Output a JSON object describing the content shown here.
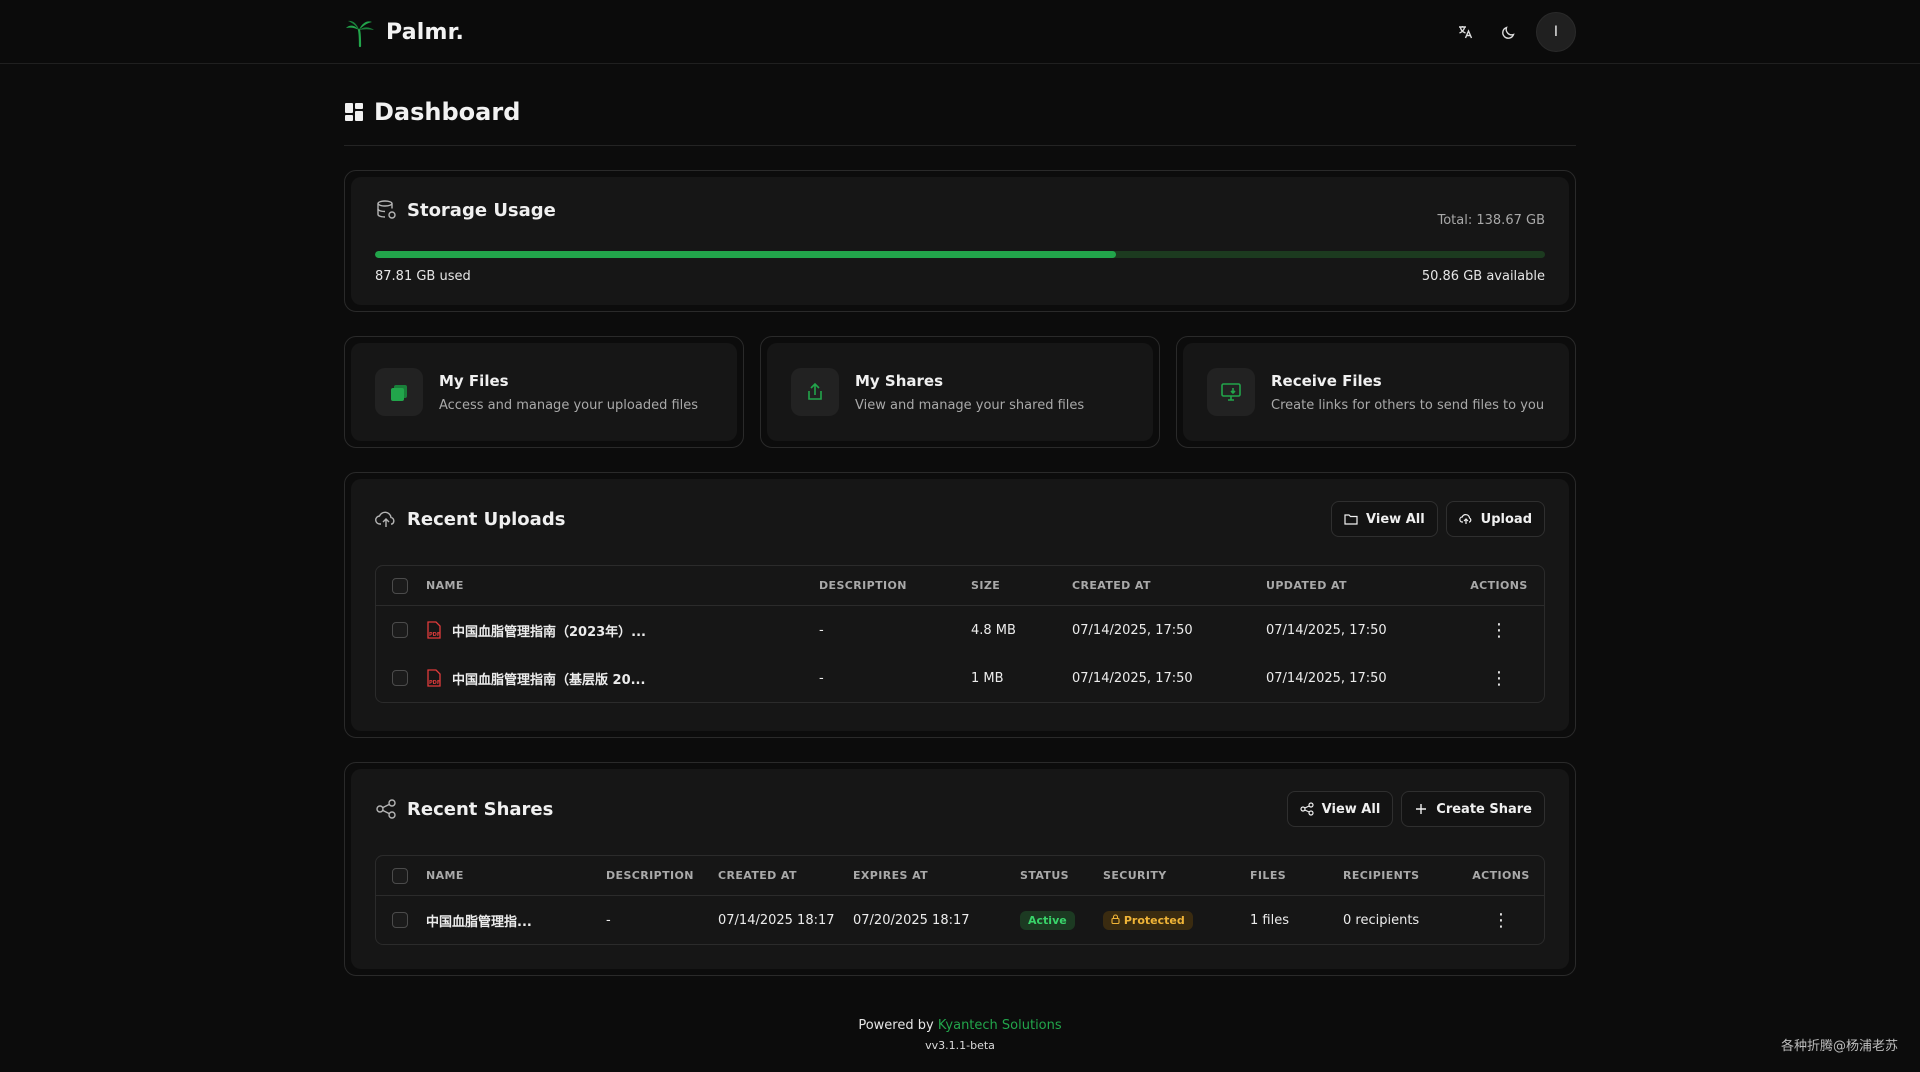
{
  "app": {
    "name": "Palmr.",
    "user_initial": "I"
  },
  "colors": {
    "accent": "#22a54b",
    "background": "#0c0c0c",
    "card": "#161616",
    "status_active": "#39d46a",
    "security_protected": "#f0b437"
  },
  "icons": {
    "translate": "translate-icon",
    "theme": "moon-icon",
    "dashboard": "dashboard-grid-icon",
    "storage": "database-icon",
    "my_files": "files-icon",
    "my_shares": "share-upload-icon",
    "receive_files": "monitor-download-icon",
    "uploads": "cloud-upload-icon",
    "shares": "share-nodes-icon",
    "folder": "folder-icon",
    "plus": "plus-icon",
    "pdf": "pdf-file-icon",
    "lock": "lock-icon",
    "more": "more-vertical-icon"
  },
  "page": {
    "title": "Dashboard"
  },
  "storage": {
    "title": "Storage Usage",
    "total": "Total: 138.67 GB",
    "used": "87.81 GB used",
    "available": "50.86 GB available",
    "used_percent": 63.3
  },
  "quick_cards": [
    {
      "title": "My Files",
      "desc": "Access and manage your uploaded files"
    },
    {
      "title": "My Shares",
      "desc": "View and manage your shared files"
    },
    {
      "title": "Receive Files",
      "desc": "Create links for others to send files to you"
    }
  ],
  "recent_uploads": {
    "title": "Recent Uploads",
    "view_all": "View All",
    "upload": "Upload",
    "columns": [
      "NAME",
      "DESCRIPTION",
      "SIZE",
      "CREATED AT",
      "UPDATED AT",
      "ACTIONS"
    ],
    "rows": [
      {
        "name": "中国血脂管理指南（2023年）...",
        "description": "-",
        "size": "4.8 MB",
        "created": "07/14/2025, 17:50",
        "updated": "07/14/2025, 17:50"
      },
      {
        "name": "中国血脂管理指南（基层版 20...",
        "description": "-",
        "size": "1 MB",
        "created": "07/14/2025, 17:50",
        "updated": "07/14/2025, 17:50"
      }
    ]
  },
  "recent_shares": {
    "title": "Recent Shares",
    "view_all": "View All",
    "create_share": "Create Share",
    "columns": [
      "NAME",
      "DESCRIPTION",
      "CREATED AT",
      "EXPIRES AT",
      "STATUS",
      "SECURITY",
      "FILES",
      "RECIPIENTS",
      "ACTIONS"
    ],
    "rows": [
      {
        "name": "中国血脂管理指...",
        "description": "-",
        "created": "07/14/2025 18:17",
        "expires": "07/20/2025 18:17",
        "status": "Active",
        "security": "Protected",
        "files": "1 files",
        "recipients": "0 recipients"
      }
    ]
  },
  "footer": {
    "powered_by": "Powered by",
    "company": "Kyantech Solutions",
    "version": "vv3.1.1-beta"
  },
  "watermark": "各种折腾@杨浦老苏"
}
